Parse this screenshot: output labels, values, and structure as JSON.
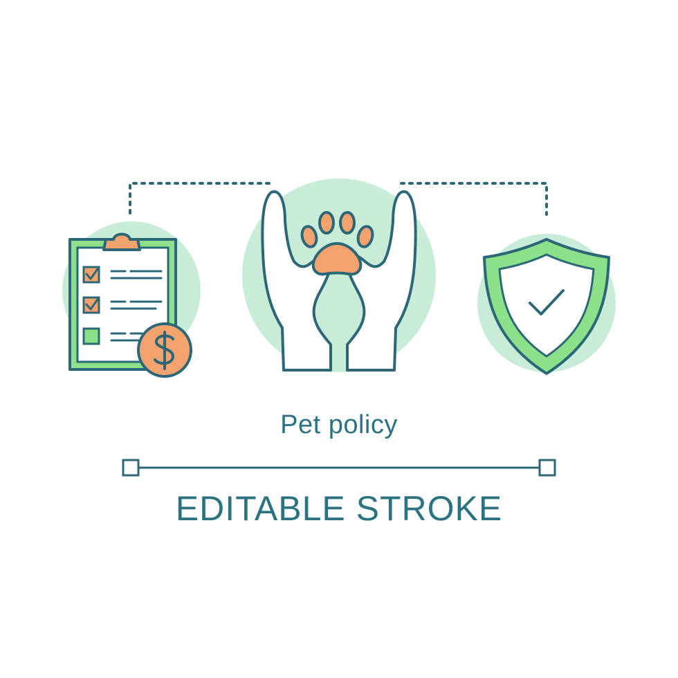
{
  "title": "Pet policy",
  "caption": "EDITABLE STROKE",
  "icons": [
    "clipboard-checklist-icon",
    "dollar-coin-icon",
    "hands-holding-paw-icon",
    "paw-icon",
    "shield-check-icon"
  ],
  "colors": {
    "stroke": "#2b6777",
    "text": "#2b7381",
    "mint": "#c9ecd9",
    "green": "#8ce08a",
    "orange": "#f5a36e"
  }
}
